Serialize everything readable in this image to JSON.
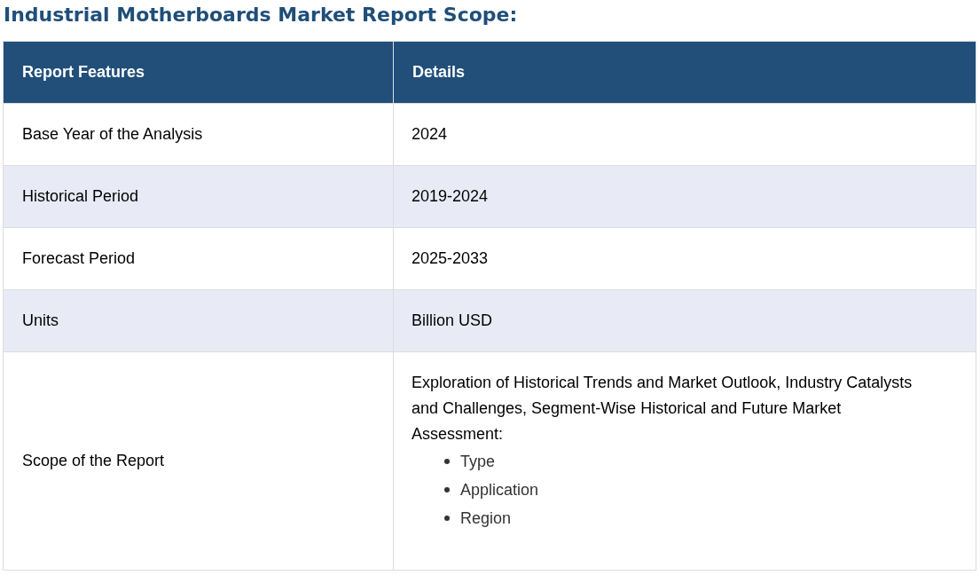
{
  "title": "Industrial Motherboards Market Report Scope:",
  "table": {
    "columns": [
      "Report Features",
      "Details"
    ],
    "rows": [
      {
        "feature": "Base Year of the Analysis",
        "details": {
          "kind": "text",
          "text": "2024"
        }
      },
      {
        "feature": "Historical Period",
        "details": {
          "kind": "text",
          "text": "2019-2024"
        }
      },
      {
        "feature": "Forecast Period",
        "details": {
          "kind": "text",
          "text": "2025-2033"
        }
      },
      {
        "feature": "Units",
        "details": {
          "kind": "text",
          "text": "Billion USD"
        }
      },
      {
        "feature": "Scope of the Report",
        "details": {
          "kind": "list",
          "text": "Exploration of Historical Trends and Market Outlook, Industry Catalysts and Challenges, Segment-Wise Historical and Future Market Assessment:",
          "items": [
            "Type",
            "Application",
            "Region"
          ]
        }
      }
    ]
  }
}
